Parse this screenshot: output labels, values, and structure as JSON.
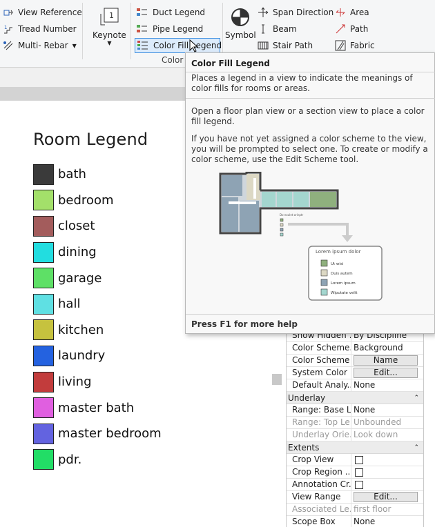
{
  "ribbon": {
    "col1": {
      "view_reference": "View Reference",
      "tread_number": "Tread Number",
      "multi_rebar": "Multi- Rebar"
    },
    "keynote": "Keynote",
    "col3": {
      "duct_legend": "Duct Legend",
      "pipe_legend": "Pipe Legend",
      "color_fill_legend": "Color Fill Legend"
    },
    "panel_label": "Color F",
    "symbol": "Symbol",
    "col5": {
      "span_direction": "Span Direction",
      "beam": "Beam",
      "stair_path": "Stair Path"
    },
    "col6": {
      "area": "Area",
      "path": "Path",
      "fabric": "Fabric"
    }
  },
  "legend": {
    "title": "Room Legend",
    "items": [
      {
        "label": "bath",
        "color": "#3a3a3a"
      },
      {
        "label": "bedroom",
        "color": "#a3e06a"
      },
      {
        "label": "closet",
        "color": "#a35c5c"
      },
      {
        "label": "dining",
        "color": "#22dde0"
      },
      {
        "label": "garage",
        "color": "#5ee066"
      },
      {
        "label": "hall",
        "color": "#5fe0e3"
      },
      {
        "label": "kitchen",
        "color": "#c6c23e"
      },
      {
        "label": "laundry",
        "color": "#2462e0"
      },
      {
        "label": "living",
        "color": "#c23c3c"
      },
      {
        "label": "master bath",
        "color": "#e05fe0"
      },
      {
        "label": "master bedroom",
        "color": "#6363e0"
      },
      {
        "label": "pdr.",
        "color": "#22dd66"
      }
    ]
  },
  "tooltip": {
    "title": "Color Fill Legend",
    "p1": "Places a legend in a view to indicate the meanings of color fills for rooms or areas.",
    "p2": "Open a floor plan view or a section view to place a color fill legend.",
    "p3": "If you have not yet assigned a color scheme to the view, you will be prompted to select one. To create or modify a color scheme, use the Edit Scheme tool.",
    "footer": "Press F1 for more help",
    "illus": {
      "small_legend_title": "Do eoulet orinptr",
      "card_title": "Lorem ipsum dolor",
      "card_items": [
        "Ut wisi",
        "Duis autem",
        "Lorem ipsum",
        "Wiputate velit"
      ],
      "card_colors": [
        "#8fb07e",
        "#dcd8c4",
        "#8ea3b4",
        "#a4d6cf"
      ]
    }
  },
  "properties": {
    "rows_top": [
      {
        "k": "Show Hidden ...",
        "v": "By Discipline",
        "type": "text"
      },
      {
        "k": "Color Scheme...",
        "v": "Background",
        "type": "text"
      },
      {
        "k": "Color Scheme",
        "v": "Name",
        "type": "button"
      },
      {
        "k": "System Color ...",
        "v": "Edit...",
        "type": "button"
      },
      {
        "k": "Default Analy...",
        "v": "None",
        "type": "text"
      }
    ],
    "underlay": "Underlay",
    "rows_underlay": [
      {
        "k": "Range: Base L...",
        "v": "None",
        "dim": false
      },
      {
        "k": "Range: Top Le...",
        "v": "Unbounded",
        "dim": true
      },
      {
        "k": "Underlay Orie...",
        "v": "Look down",
        "dim": true
      }
    ],
    "extents": "Extents",
    "crop_view": "Crop View",
    "crop_region": "Crop Region ...",
    "annotation_crop": "Annotation Cr...",
    "view_range": "View Range",
    "view_range_btn": "Edit...",
    "associated": "Associated Le...",
    "associated_val": "first floor",
    "scope_box": "Scope Box",
    "scope_box_val": "None"
  }
}
